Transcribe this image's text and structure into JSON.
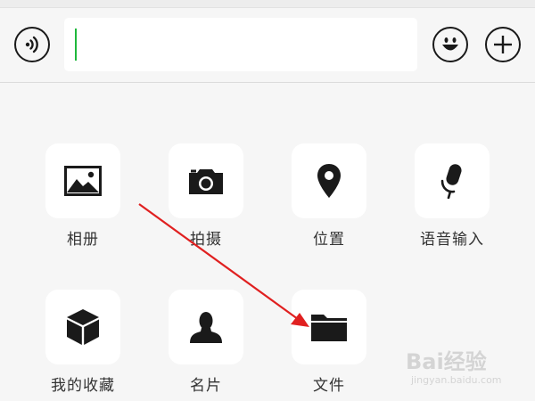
{
  "input_bar": {
    "text_value": "",
    "voice_icon": "voice-icon",
    "emoji_icon": "emoji-icon",
    "plus_icon": "plus-icon"
  },
  "panel": {
    "items": [
      {
        "label": "相册",
        "icon": "album-icon"
      },
      {
        "label": "拍摄",
        "icon": "camera-icon"
      },
      {
        "label": "位置",
        "icon": "location-icon"
      },
      {
        "label": "语音输入",
        "icon": "microphone-icon"
      },
      {
        "label": "我的收藏",
        "icon": "favorites-cube-icon"
      },
      {
        "label": "名片",
        "icon": "contact-card-icon"
      },
      {
        "label": "文件",
        "icon": "folder-icon"
      }
    ]
  },
  "annotation": {
    "color": "#e02020"
  },
  "watermark": {
    "main": "Bai经验",
    "sub": "jingyan.baidu.com"
  },
  "colors": {
    "caret": "#1fb83c",
    "tile_bg": "#ffffff",
    "panel_bg": "#f6f6f6"
  }
}
